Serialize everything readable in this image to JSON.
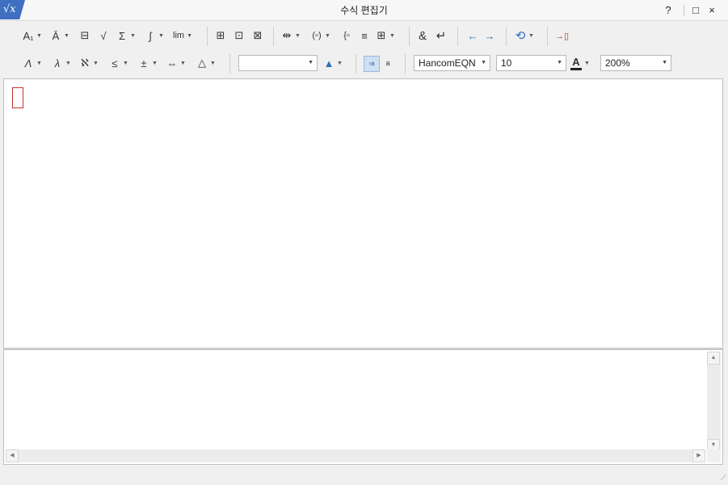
{
  "window": {
    "title": "수식 편집기",
    "app_icon_glyph": "√x",
    "help_label": "?",
    "maximize_glyph": "□",
    "close_glyph": "×"
  },
  "toolbar1": {
    "subscript_glyph": "A₁",
    "decoration_glyph": "Ā",
    "fraction_glyph": "⊟",
    "root_glyph": "√",
    "sum_glyph": "Σ",
    "integral_glyph": "∫",
    "limit_glyph": "lim",
    "matrix1_glyph": "⊞",
    "matrix2_glyph": "⊡",
    "matrix3_glyph": "⊠",
    "arrange_glyph": "⇹",
    "bracket_glyph": "(▫)",
    "cases_glyph": "{▫",
    "equals_glyph": "≡",
    "grid_glyph": "⊞",
    "ampersand_glyph": "&",
    "newline_glyph": "↵",
    "undo_glyph": "←",
    "redo_glyph": "→",
    "convert_glyph": "⟲",
    "exit_glyph": "→▯"
  },
  "toolbar2": {
    "greek_upper_glyph": "Λ",
    "greek_lower_glyph": "λ",
    "hebrew_glyph": "ℵ",
    "relation_glyph": "≤",
    "operator_glyph": "±",
    "arrow_glyph": "⇔",
    "misc_glyph": "△",
    "command_value": "",
    "style_glyph": "▲",
    "view_mode1_glyph": "▫a",
    "view_mode2_glyph": "a",
    "font_value": "HancomEQN",
    "size_value": "10",
    "color_glyph": "A",
    "zoom_value": "200%"
  },
  "script": {
    "text": ""
  },
  "scroll": {
    "up": "▲",
    "down": "▼",
    "left": "◀",
    "right": "▶"
  },
  "colors": {
    "accent": "#3f6fc0",
    "cursor": "#c63030"
  }
}
